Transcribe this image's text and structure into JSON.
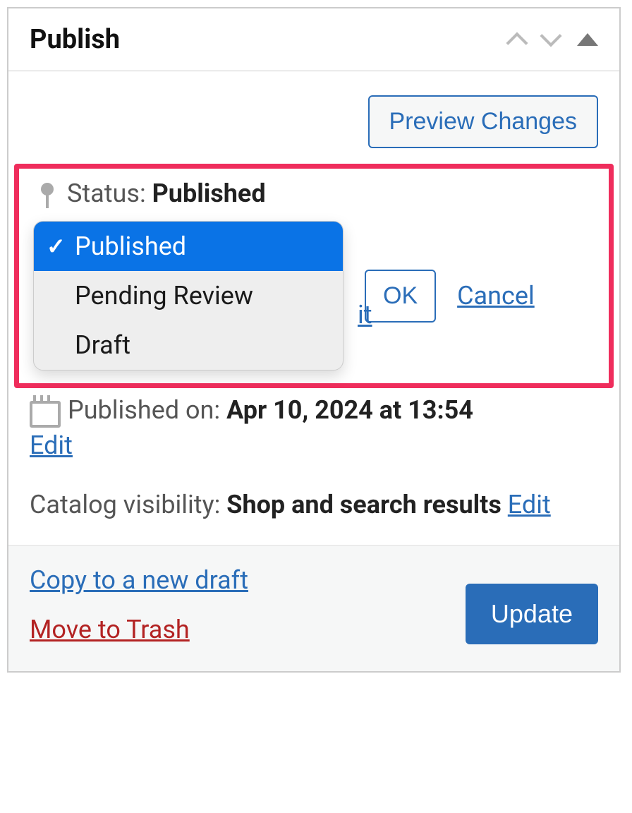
{
  "panel": {
    "title": "Publish"
  },
  "actions": {
    "preview": "Preview Changes",
    "ok": "OK",
    "cancel": "Cancel",
    "update": "Update",
    "copy_draft": "Copy to a new draft",
    "move_trash": "Move to Trash"
  },
  "status": {
    "label": "Status:",
    "value": "Published",
    "options": [
      "Published",
      "Pending Review",
      "Draft"
    ],
    "hidden_link_fragment": "it"
  },
  "date": {
    "label": "Published on:",
    "value": "Apr 10, 2024 at 13:54",
    "edit": "Edit"
  },
  "catalog": {
    "label": "Catalog visibility:",
    "value": "Shop and search results",
    "edit": "Edit"
  }
}
